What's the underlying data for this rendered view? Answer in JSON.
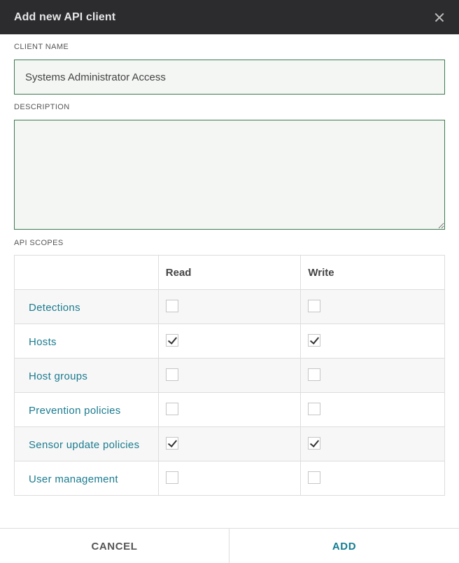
{
  "dialog": {
    "title": "Add new API client"
  },
  "form": {
    "client_name_label": "CLIENT NAME",
    "client_name_value": "Systems Administrator Access",
    "description_label": "DESCRIPTION",
    "description_value": "",
    "scopes_label": "API SCOPES"
  },
  "scopes_table": {
    "headers": [
      "",
      "Read",
      "Write"
    ],
    "rows": [
      {
        "name": "Detections",
        "read": false,
        "write": false
      },
      {
        "name": "Hosts",
        "read": true,
        "write": true
      },
      {
        "name": "Host groups",
        "read": false,
        "write": false
      },
      {
        "name": "Prevention policies",
        "read": false,
        "write": false
      },
      {
        "name": "Sensor update policies",
        "read": true,
        "write": true
      },
      {
        "name": "User management",
        "read": false,
        "write": false
      }
    ]
  },
  "footer": {
    "cancel_label": "CANCEL",
    "add_label": "ADD"
  },
  "colors": {
    "header_bg": "#2c2b2e",
    "input_border": "#3d7a52",
    "link": "#1b7b8f",
    "add_button": "#137d92"
  },
  "icons": {
    "close": "close-icon",
    "checkbox_checked": "checkmark-icon"
  }
}
